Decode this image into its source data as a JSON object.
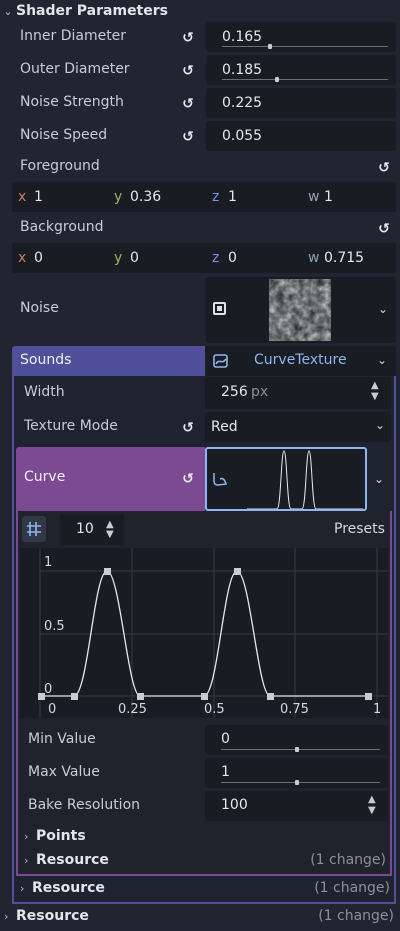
{
  "header": {
    "title": "Shader Parameters"
  },
  "params": {
    "inner_diameter": {
      "label": "Inner Diameter",
      "value": "0.165"
    },
    "outer_diameter": {
      "label": "Outer Diameter",
      "value": "0.185"
    },
    "noise_strength": {
      "label": "Noise Strength",
      "value": "0.225"
    },
    "noise_speed": {
      "label": "Noise Speed",
      "value": "0.055"
    },
    "foreground": {
      "label": "Foreground",
      "x": "1",
      "y": "0.36",
      "z": "1",
      "w": "1"
    },
    "background": {
      "label": "Background",
      "x": "0",
      "y": "0",
      "z": "0",
      "w": "0.715"
    },
    "noise": {
      "label": "Noise"
    }
  },
  "axis_keys": {
    "x": "x",
    "y": "y",
    "z": "z",
    "w": "w"
  },
  "sounds": {
    "label": "Sounds",
    "resource_type": "CurveTexture",
    "width": {
      "label": "Width",
      "value": "256",
      "unit": "px"
    },
    "texture_mode": {
      "label": "Texture Mode",
      "value": "Red"
    },
    "curve": {
      "label": "Curve",
      "editor": {
        "snap_value": "10",
        "presets_label": "Presets",
        "y_ticks": [
          "1",
          "0.5",
          "0"
        ],
        "x_ticks": [
          "0",
          "0.25",
          "0.5",
          "0.75",
          "1"
        ]
      },
      "min_value": {
        "label": "Min Value",
        "value": "0"
      },
      "max_value": {
        "label": "Max Value",
        "value": "1"
      },
      "bake_resolution": {
        "label": "Bake Resolution",
        "value": "100"
      },
      "points_label": "Points",
      "resource_label": "Resource",
      "resource_change": "(1 change)"
    },
    "resource_label": "Resource",
    "resource_change": "(1 change)"
  },
  "footer": {
    "resource_label": "Resource",
    "resource_change": "(1 change)"
  },
  "colors": {
    "sounds_header": "#4f4f9a",
    "curve_header": "#7b4a93",
    "accent_blue": "#8fb6f0"
  }
}
